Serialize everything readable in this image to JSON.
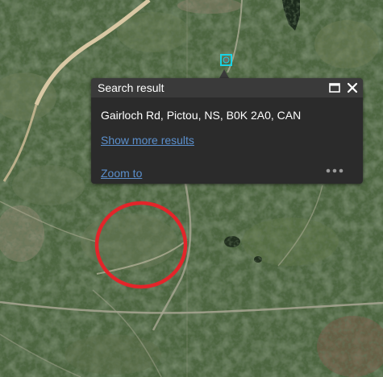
{
  "map": {
    "result_marker_icon": "square-location-marker-icon",
    "highlight_icon": "red-circle-annotation-icon",
    "colors": {
      "marker": "#19d3e6",
      "circle": "#e3252a",
      "popup_bg": "#2b2b2b",
      "link": "#5b8fcc"
    }
  },
  "popup": {
    "title": "Search result",
    "address": "Gairloch Rd, Pictou, NS, B0K 2A0, CAN",
    "show_more_label": "Show more results",
    "zoom_label": "Zoom to",
    "maximize_icon": "maximize-icon",
    "close_icon": "close-icon",
    "menu_icon": "more-options-icon"
  }
}
